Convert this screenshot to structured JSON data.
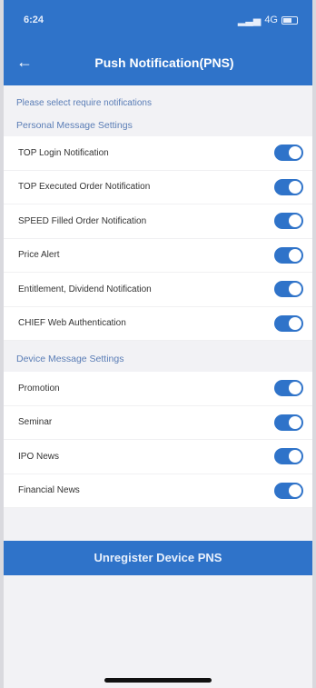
{
  "status_bar": {
    "time": "6:24",
    "network": "4G"
  },
  "nav": {
    "title": "Push Notification(PNS)",
    "back_icon": "arrow-left-icon"
  },
  "instruction": "Please select require notifications",
  "personal": {
    "header": "Personal Message Settings",
    "items": [
      {
        "label": "TOP Login Notification",
        "on": true
      },
      {
        "label": "TOP Executed Order Notification",
        "on": true
      },
      {
        "label": "SPEED Filled Order Notification",
        "on": true
      },
      {
        "label": "Price Alert",
        "on": true
      },
      {
        "label": "Entitlement, Dividend Notification",
        "on": true
      },
      {
        "label": "CHIEF Web Authentication",
        "on": true
      }
    ]
  },
  "device": {
    "header": "Device Message Settings",
    "items": [
      {
        "label": "Promotion",
        "on": true
      },
      {
        "label": "Seminar",
        "on": true
      },
      {
        "label": "IPO News",
        "on": true
      },
      {
        "label": "Financial News",
        "on": true
      }
    ]
  },
  "unregister_label": "Unregister Device PNS",
  "colors": {
    "accent": "#2f73c9",
    "section_text": "#5a7db6"
  }
}
